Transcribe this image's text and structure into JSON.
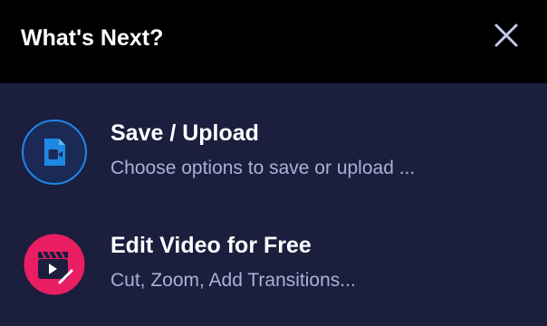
{
  "dialog": {
    "title": "What's Next?",
    "close_icon": "close-icon"
  },
  "options": [
    {
      "title": "Save / Upload",
      "subtitle": "Choose options to save or upload ...",
      "icon": "video-file-icon",
      "accent": "#1e88e5"
    },
    {
      "title": "Edit Video for Free",
      "subtitle": "Cut, Zoom, Add Transitions...",
      "icon": "video-editor-icon",
      "accent": "#e91e63"
    }
  ],
  "colors": {
    "header_bg": "#000000",
    "body_bg": "#1b1e3d",
    "title_text": "#ffffff",
    "subtitle_text": "#aab0d6"
  }
}
